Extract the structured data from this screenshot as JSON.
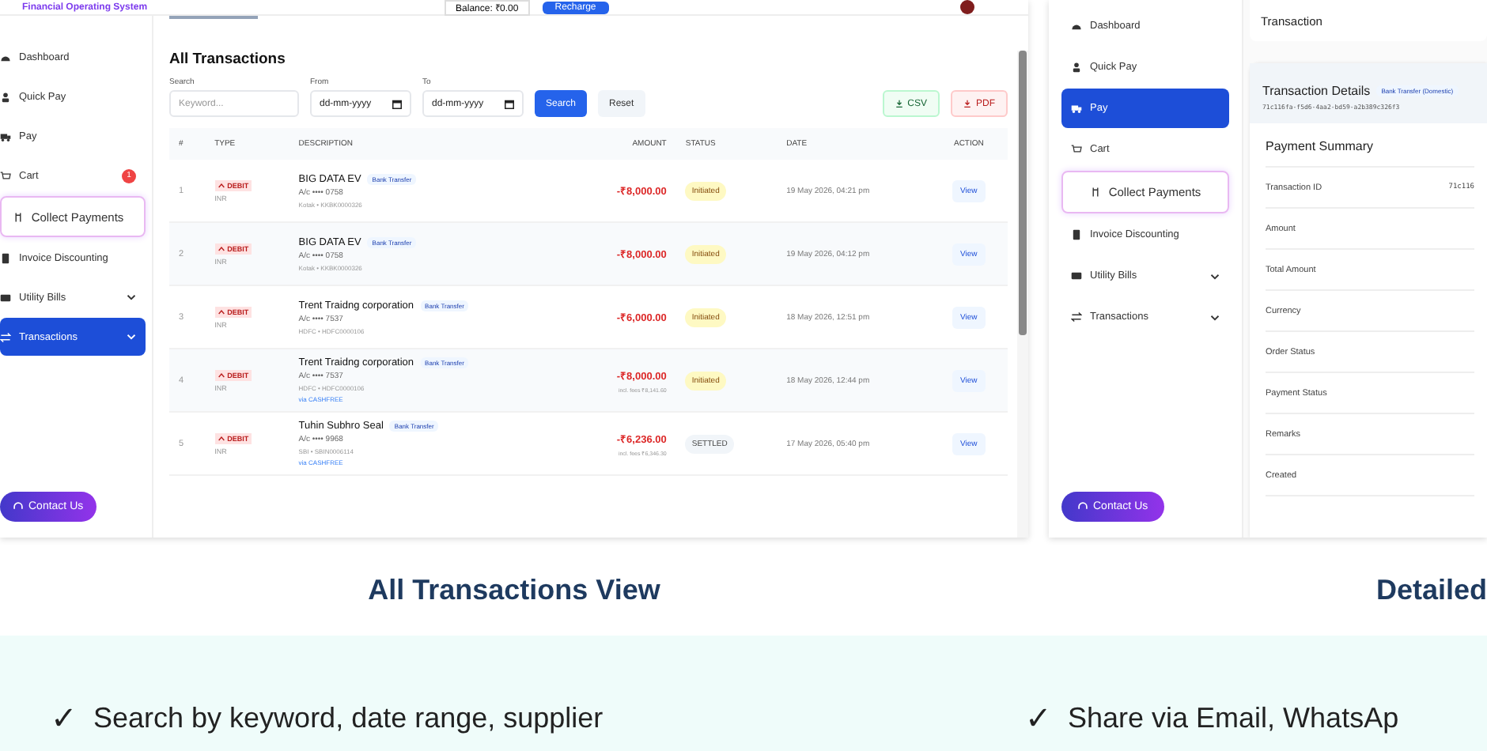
{
  "left_screen": {
    "brand": "Financial Operating System",
    "balance": "Balance: ₹0.00",
    "recharge": "Recharge",
    "sidebar": [
      {
        "label": "Dashboard",
        "kind": "item",
        "selected": false,
        "submenu": false
      },
      {
        "label": "Quick Pay",
        "kind": "item",
        "selected": false,
        "submenu": false
      },
      {
        "label": "Pay",
        "kind": "item",
        "selected": false,
        "submenu": false
      },
      {
        "label": "Cart",
        "kind": "item",
        "selected": false,
        "submenu": false,
        "badge": "1"
      },
      {
        "label": "Collect Payments",
        "kind": "featured",
        "selected": false,
        "submenu": false
      },
      {
        "label": "Invoice Discounting",
        "kind": "item",
        "selected": false,
        "submenu": false
      },
      {
        "label": "Utility Bills",
        "kind": "item",
        "selected": false,
        "submenu": true
      },
      {
        "label": "Transactions",
        "kind": "item",
        "selected": true,
        "submenu": true
      }
    ],
    "contact": "Contact Us",
    "heading": "All Transactions",
    "filters": {
      "search_label": "Search",
      "search_placeholder": "Keyword...",
      "from_label": "From",
      "from_value": "dd-mm-yyyy",
      "to_label": "To",
      "to_value": "dd-mm-yyyy",
      "search_button": "Search",
      "reset_button": "Reset",
      "csv": "CSV",
      "pdf": "PDF"
    },
    "columns": [
      "#",
      "TYPE",
      "DESCRIPTION",
      "AMOUNT",
      "STATUS",
      "DATE",
      "ACTION"
    ],
    "rows": [
      {
        "no": "1",
        "type": "DEBIT",
        "currency": "INR",
        "name": "BIG DATA EV",
        "tag": "Bank Transfer",
        "account": "A/c •••• 0758",
        "bank": "Kotak • KKBK0000326",
        "amount": "-₹8,000.00",
        "status": "Initiated",
        "kind": "initiated",
        "date": "19 May 2026, 04:21 pm",
        "action": "View"
      },
      {
        "no": "2",
        "type": "DEBIT",
        "currency": "INR",
        "name": "BIG DATA EV",
        "tag": "Bank Transfer",
        "account": "A/c •••• 0758",
        "bank": "Kotak • KKBK0000326",
        "amount": "-₹8,000.00",
        "status": "Initiated",
        "kind": "initiated",
        "date": "19 May 2026, 04:12 pm",
        "action": "View"
      },
      {
        "no": "3",
        "type": "DEBIT",
        "currency": "INR",
        "name": "Trent Traidng corporation",
        "tag": "Bank Transfer",
        "account": "A/c •••• 7537",
        "bank": "HDFC • HDFC0000106",
        "amount": "-₹6,000.00",
        "status": "Initiated",
        "kind": "initiated",
        "date": "18 May 2026, 12:51 pm",
        "action": "View"
      },
      {
        "no": "4",
        "type": "DEBIT",
        "currency": "INR",
        "name": "Trent Traidng corporation",
        "tag": "Bank Transfer",
        "account": "A/c •••• 7537",
        "bank": "HDFC • HDFC0000106",
        "via": "via CASHFREE",
        "amount": "-₹8,000.00",
        "fees": "incl. fees ₹8,141.60",
        "status": "Initiated",
        "kind": "initiated",
        "date": "18 May 2026, 12:44 pm",
        "action": "View"
      },
      {
        "no": "5",
        "type": "DEBIT",
        "currency": "INR",
        "name": "Tuhin Subhro Seal",
        "tag": "Bank Transfer",
        "account": "A/c •••• 9968",
        "bank": "SBI • SBIN0006114",
        "via": "via CASHFREE",
        "amount": "-₹6,236.00",
        "fees": "incl. fees ₹6,346.30",
        "status": "SETTLED",
        "kind": "settled",
        "date": "17 May 2026, 05:40 pm",
        "action": "View"
      }
    ]
  },
  "right_screen": {
    "sidebar": [
      {
        "label": "Dashboard",
        "kind": "item",
        "selected": false,
        "submenu": false
      },
      {
        "label": "Quick Pay",
        "kind": "item",
        "selected": false,
        "submenu": false
      },
      {
        "label": "Pay",
        "kind": "item",
        "selected": true,
        "submenu": false
      },
      {
        "label": "Cart",
        "kind": "item",
        "selected": false,
        "submenu": false
      },
      {
        "label": "Collect Payments",
        "kind": "featured",
        "selected": false,
        "submenu": false
      },
      {
        "label": "Invoice Discounting",
        "kind": "item",
        "selected": false,
        "submenu": false
      },
      {
        "label": "Utility Bills",
        "kind": "item",
        "selected": false,
        "submenu": true
      },
      {
        "label": "Transactions",
        "kind": "item",
        "selected": false,
        "submenu": true
      }
    ],
    "contact": "Contact Us",
    "header": "Transaction",
    "details_title": "Transaction Details",
    "details_tag": "Bank Transfer (Domestic)",
    "details_id": "71c116fa-f5d6-4aa2-bd59-a2b389c326f3",
    "summary_title": "Payment Summary",
    "summary": [
      {
        "label": "Transaction ID",
        "value": "71c116"
      },
      {
        "label": "Amount"
      },
      {
        "label": "Total Amount"
      },
      {
        "label": "Currency"
      },
      {
        "label": "Order Status"
      },
      {
        "label": "Payment Status"
      },
      {
        "label": "Remarks"
      },
      {
        "label": "Created"
      }
    ]
  },
  "captions": [
    "All Transactions View",
    "Detailed"
  ],
  "features": [
    {
      "mark": "✓",
      "text": "Search by keyword, date range, supplier"
    },
    {
      "mark": "✓",
      "text": "Share via Email, WhatsAp"
    }
  ]
}
